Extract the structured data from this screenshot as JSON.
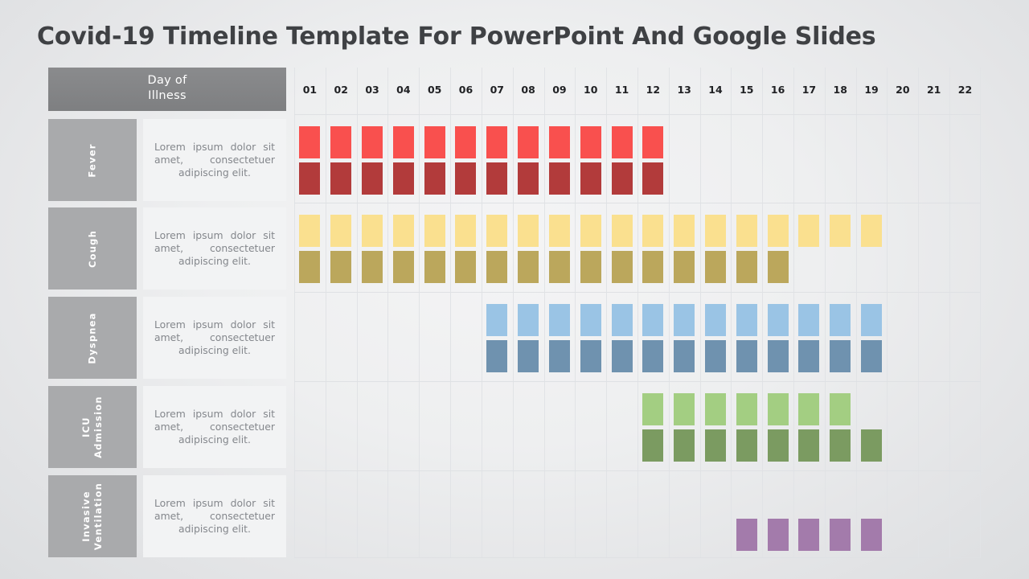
{
  "title": "Covid-19 Timeline Template For PowerPoint And Google Slides",
  "header": {
    "day_of_label_line1": "Day of",
    "day_of_label_line2": "Illness",
    "days": [
      "01",
      "02",
      "03",
      "04",
      "05",
      "06",
      "07",
      "08",
      "09",
      "10",
      "11",
      "12",
      "13",
      "14",
      "15",
      "16",
      "17",
      "18",
      "19",
      "20",
      "21",
      "22"
    ]
  },
  "description_text": "Lorem ipsum dolor sit amet, consectetuer adipiscing elit.",
  "colors": {
    "header_gray": "#7e7f81",
    "label_gray": "#a9aaac",
    "desc_bg": "#f2f3f4",
    "title_text": "#3f4144",
    "grid_line": "#e1e3e6",
    "fever_light": "#f9504e",
    "fever_dark": "#b23b3b",
    "cough_light": "#fae08f",
    "cough_dark": "#bba75c",
    "dyspnea_light": "#9ac4e5",
    "dyspnea_dark": "#6f92af",
    "icu_light": "#a3ce82",
    "icu_dark": "#7b9b61",
    "vent_dark": "#a37bab"
  },
  "chart_data": {
    "type": "bar",
    "title": "Covid-19 Timeline Template For PowerPoint And Google Slides",
    "xlabel": "Day of Illness",
    "ylabel": "",
    "categories": [
      "01",
      "02",
      "03",
      "04",
      "05",
      "06",
      "07",
      "08",
      "09",
      "10",
      "11",
      "12",
      "13",
      "14",
      "15",
      "16",
      "17",
      "18",
      "19",
      "20",
      "21",
      "22"
    ],
    "legend_position": "none",
    "grid": true,
    "series": [
      {
        "name": "Fever",
        "label": "Fever",
        "description": "Lorem ipsum dolor sit amet, consectetuer adipiscing elit.",
        "top_color": "#f9504e",
        "bottom_color": "#b23b3b",
        "top_days": [
          1,
          2,
          3,
          4,
          5,
          6,
          7,
          8,
          9,
          10,
          11,
          12
        ],
        "bottom_days": [
          1,
          2,
          3,
          4,
          5,
          6,
          7,
          8,
          9,
          10,
          11,
          12
        ]
      },
      {
        "name": "Cough",
        "label": "Cough",
        "description": "Lorem ipsum dolor sit amet, consectetuer adipiscing elit.",
        "top_color": "#fae08f",
        "bottom_color": "#bba75c",
        "top_days": [
          1,
          2,
          3,
          4,
          5,
          6,
          7,
          8,
          9,
          10,
          11,
          12,
          13,
          14,
          15,
          16,
          17,
          18,
          19
        ],
        "bottom_days": [
          1,
          2,
          3,
          4,
          5,
          6,
          7,
          8,
          9,
          10,
          11,
          12,
          13,
          14,
          15,
          16
        ]
      },
      {
        "name": "Dyspnea",
        "label": "Dyspnea",
        "description": "Lorem ipsum dolor sit amet, consectetuer adipiscing elit.",
        "top_color": "#9ac4e5",
        "bottom_color": "#6f92af",
        "top_days": [
          7,
          8,
          9,
          10,
          11,
          12,
          13,
          14,
          15,
          16,
          17,
          18,
          19
        ],
        "bottom_days": [
          7,
          8,
          9,
          10,
          11,
          12,
          13,
          14,
          15,
          16,
          17,
          18,
          19
        ]
      },
      {
        "name": "ICU Admission",
        "label": "ICU\nAdmission",
        "description": "Lorem ipsum dolor sit amet, consectetuer adipiscing elit.",
        "top_color": "#a3ce82",
        "bottom_color": "#7b9b61",
        "top_days": [
          12,
          13,
          14,
          15,
          16,
          17,
          18
        ],
        "bottom_days": [
          12,
          13,
          14,
          15,
          16,
          17,
          18,
          19
        ]
      },
      {
        "name": "Invasive Ventilation",
        "label": "Invasive\nVentilation",
        "description": "Lorem ipsum dolor sit amet, consectetuer adipiscing elit.",
        "top_color": "#c9a8d0",
        "bottom_color": "#a37bab",
        "top_days": [],
        "bottom_days": [
          15,
          16,
          17,
          18,
          19
        ]
      }
    ]
  }
}
